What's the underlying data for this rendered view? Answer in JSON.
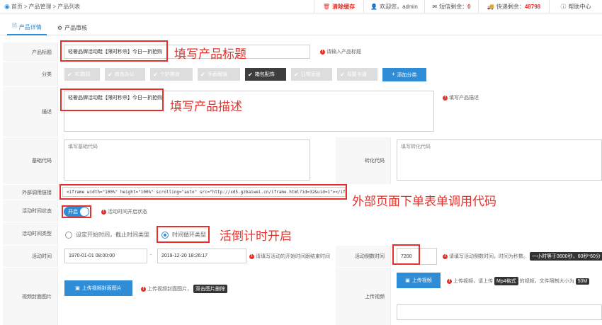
{
  "topbar": {
    "breadcrumb": [
      "首页",
      "产品管理",
      "产品列表"
    ],
    "breadcrumb_sep": ">",
    "clear_cache": "清除缓存",
    "welcome": "欢迎您，admin",
    "sms_label": "短信剩余：",
    "sms_count": "0",
    "express_label": "快递剩余：",
    "express_count": "48798",
    "help": "帮助中心"
  },
  "tabs": [
    {
      "label": "产品详情",
      "active": true
    },
    {
      "label": "产品审核",
      "active": false
    }
  ],
  "form": {
    "title": {
      "label": "产品标题",
      "value": "轻奢品牌活动鞋【限时秒杀】今日一折抢购",
      "hint": "请输入产品标题",
      "annotation": "填写产品标题"
    },
    "category": {
      "label": "分类",
      "items": [
        {
          "label": "3C数码",
          "selected": false
        },
        {
          "label": "商务办公",
          "selected": false
        },
        {
          "label": "个护美妆",
          "selected": false
        },
        {
          "label": "手表眼镜",
          "selected": false
        },
        {
          "label": "箱包配饰",
          "selected": true
        },
        {
          "label": "日常家居",
          "selected": false
        },
        {
          "label": "母婴卡通",
          "selected": false
        }
      ],
      "add_button": "添加分类"
    },
    "description": {
      "label": "描述",
      "value": "轻奢品牌活动鞋【限时秒杀】今日一折抢购",
      "hint": "填写产品描述",
      "annotation": "填写产品描述"
    },
    "base_code": {
      "label": "基础代码",
      "placeholder": "填写基础代码",
      "convert_label": "转化代码",
      "convert_placeholder": "填写转化代码"
    },
    "external": {
      "label": "外部调用链接",
      "value": "<iframe width=\"100%\" height=\"100%\" scrolling=\"auto\" src=\"http://xd5.gzbaiwei.cn/iframe.html?id=32&uid=1\"></iframe>",
      "annotation": "外部页面下单表单调用代码"
    },
    "activity_status": {
      "label": "活动时间状态",
      "toggle_text": "开启",
      "hint": "活动时间开启状态"
    },
    "activity_type": {
      "label": "活动时间类型",
      "options": [
        {
          "label": "设定开始时间，截止时间类型",
          "checked": false
        },
        {
          "label": "时间循环类型",
          "checked": true
        }
      ],
      "annotation": "活倒计时开启"
    },
    "activity_time": {
      "label": "活动时间",
      "start": "1970-01-01 08:00:00",
      "dash": "-",
      "end": "2019-12-20 18:26:17",
      "hint": "请填写活动的开始时间跟结束时间",
      "countdown_label": "活动倒数时间",
      "countdown_value": "7200",
      "countdown_hint": "请填写活动倒数时间，时间为秒数。",
      "countdown_tag": "一小时等于3600秒，60秒*60分"
    },
    "video_cover": {
      "label": "视频封面图片",
      "button": "上传视频封面图片",
      "hint": "上传视频封面图片，",
      "tag": "双击图片删除"
    },
    "video": {
      "label": "上传视频",
      "button": "上传视频",
      "hint_pre": "上传视频，请上传",
      "format_tag": "Mp4格式",
      "hint_mid": "的视频，文件限制大小为",
      "size_tag": "50M"
    }
  },
  "colors": {
    "accent": "#2f8cd6",
    "annotation_red": "#e5312b",
    "selected_category": "#3d3d3d"
  }
}
